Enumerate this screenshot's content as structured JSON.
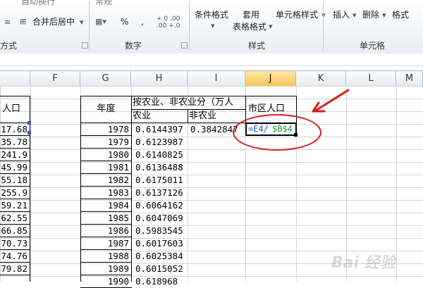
{
  "ribbon": {
    "wrap_text": "自动换行",
    "merge_center": "合并后居中",
    "number_format": "常规",
    "percent": "%",
    "comma": ",",
    "inc_decimal": "+.0 .00",
    "dec_decimal": ".00 +.0",
    "cond_format": "条件格式",
    "table_format_1": "套用",
    "table_format_2": "表格格式",
    "cell_styles": "单元格样式",
    "insert": "插入",
    "delete": "删除",
    "format": "格式",
    "groups": {
      "alignment": "方式",
      "number": "数字",
      "styles": "样式",
      "cells": "单元格"
    }
  },
  "columns": [
    {
      "label": "F"
    },
    {
      "label": "G"
    },
    {
      "label": "H"
    },
    {
      "label": "I"
    },
    {
      "label": "J",
      "selected": true
    },
    {
      "label": "K"
    },
    {
      "label": "L"
    },
    {
      "label": "M"
    }
  ],
  "table_left_header": "人口",
  "col_e_values": [
    "17.68",
    "35.78",
    "241.9",
    "45.99",
    "55.18",
    "255.9",
    "59.21",
    "62.55",
    "66.85",
    "70.73",
    "74.76",
    "79.82"
  ],
  "table_right": {
    "header_year": "年度",
    "header_split": "按农业、非农业分（万人",
    "header_agri": "农业",
    "header_nonagri": "非农业",
    "header_urban": "市区人口",
    "years": [
      "1978",
      "1979",
      "1980",
      "1981",
      "1982",
      "1983",
      "1984",
      "1985",
      "1986",
      "1987",
      "1988",
      "1989",
      "1990"
    ],
    "agri_values": [
      "0.6144397",
      "0.6123987",
      "0.6140825",
      "0.6136488",
      "0.6175011",
      "0.6137126",
      "0.6064162",
      "0.6047069",
      "0.5983545",
      "0.6017603",
      "0.6025384",
      "0.6015052",
      "0.618968"
    ],
    "nonagri_first": "0.3842847"
  },
  "formula": {
    "part1": "=E4/",
    "part2": "$B$4"
  },
  "colors": {
    "annotation_red": "#d81e1e",
    "formula_ref_blue": "#1f4ec4",
    "formula_ref_green": "#1e9a3c",
    "selected_col": "#f5c55b"
  },
  "watermark": "Bai 经验"
}
